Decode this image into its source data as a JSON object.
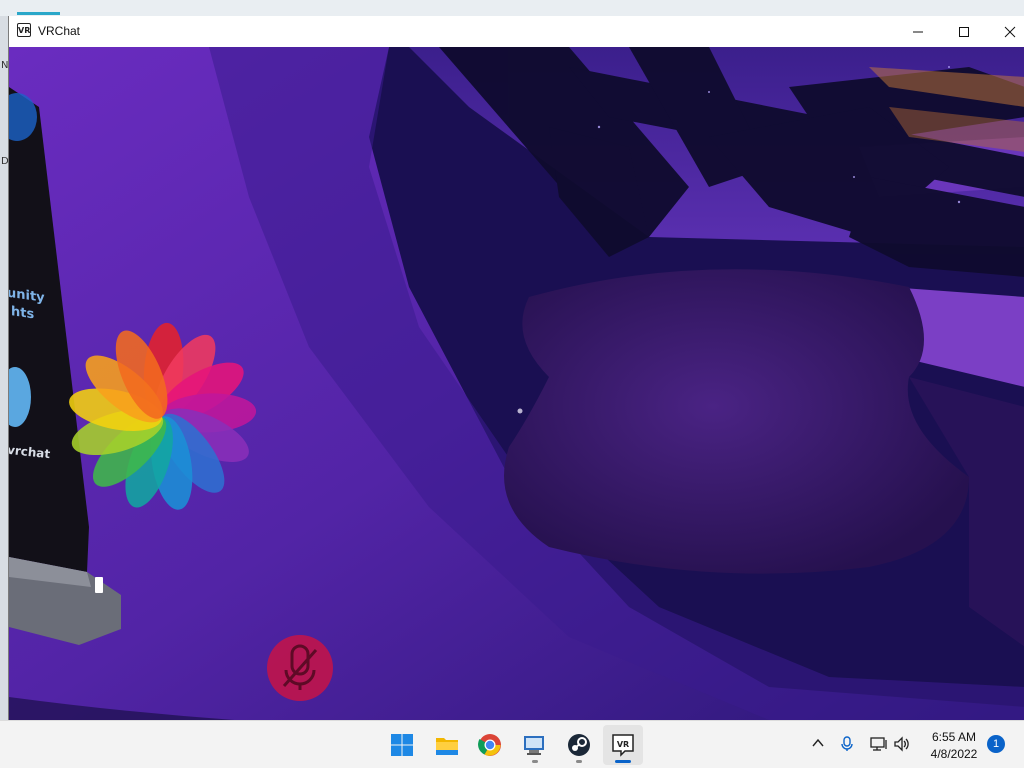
{
  "window": {
    "title": "VRChat",
    "app_icon_text": "VR",
    "controls": {
      "minimize": "minimize",
      "maximize": "maximize",
      "close": "close"
    }
  },
  "scene": {
    "sign_lines": [
      "unity",
      "hts",
      "vrchat"
    ],
    "muted_indicator": "mic-muted-icon",
    "logo": "rainbow-flower-logo"
  },
  "desktop_edge_text": [
    "N",
    "D"
  ],
  "taskbar": {
    "apps": [
      {
        "name": "Start",
        "icon": "windows-start-icon",
        "active": false,
        "running": false
      },
      {
        "name": "File Explorer",
        "icon": "folder-icon",
        "active": false,
        "running": false
      },
      {
        "name": "Google Chrome",
        "icon": "chrome-icon",
        "active": false,
        "running": false
      },
      {
        "name": "Remote Desktop",
        "icon": "remote-desktop-icon",
        "active": false,
        "running": true
      },
      {
        "name": "Steam",
        "icon": "steam-icon",
        "active": false,
        "running": true
      },
      {
        "name": "VRChat",
        "icon": "vrchat-icon",
        "active": true,
        "running": true
      }
    ],
    "tray": {
      "icons": [
        "chevron-up-icon",
        "microphone-icon",
        "network-icon",
        "volume-icon"
      ],
      "time": "6:55 AM",
      "date": "4/8/2022",
      "notification_count": "1"
    }
  },
  "colors": {
    "scene_purple": "#5a23a8",
    "scene_dark": "#120d40",
    "muted_red": "#c0144b",
    "accent_blue": "#0a63c9"
  }
}
